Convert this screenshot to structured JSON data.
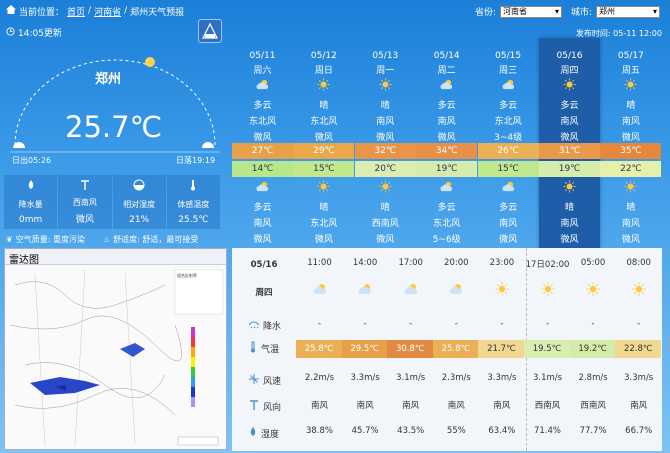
{
  "breadcrumb": {
    "label": "当前位置：",
    "home": "首页",
    "province": "河南省",
    "page": "郑州天气预报",
    "sep": "/"
  },
  "selectors": {
    "province_label": "省份:",
    "province_value": "河南省",
    "city_label": "城市:",
    "city_value": "郑州"
  },
  "update_time": "14:05更新",
  "publish_time": "发布时间:  05-11 12:00",
  "current": {
    "city": "郑州",
    "temp": "25.7℃",
    "sunrise": "日出05:26",
    "sunset": "日落19:19",
    "stats": [
      {
        "icon": "rain-icon",
        "label": "降水量",
        "value": "0mm"
      },
      {
        "icon": "wind-icon",
        "label": "西南风",
        "value": "微风"
      },
      {
        "icon": "humidity-icon",
        "label": "相对湿度",
        "value": "21%"
      },
      {
        "icon": "thermometer-icon",
        "label": "体感温度",
        "value": "25.5℃"
      }
    ],
    "air_quality": "空气质量: 重度污染",
    "comfort": "舒适度: 舒适，最可接受"
  },
  "radar": {
    "title": "雷达图",
    "legend_title": "组合反射率"
  },
  "daily": [
    {
      "date": "05/11",
      "week": "周六",
      "day_icon": "partly-cloudy",
      "day_weather": "多云",
      "day_wind_dir": "东北风",
      "day_wind": "微风",
      "high": "27℃",
      "high_color": "#e8a04a",
      "low": "14℃",
      "low_color": "#b8e68a",
      "night_icon": "partly-cloudy",
      "night_weather": "多云",
      "night_wind_dir": "南风",
      "night_wind": "微风"
    },
    {
      "date": "05/12",
      "week": "周日",
      "day_icon": "sun",
      "day_weather": "晴",
      "day_wind_dir": "东北风",
      "day_wind": "微风",
      "high": "29℃",
      "high_color": "#eba84a",
      "low": "15℃",
      "low_color": "#c2e88e",
      "night_icon": "sun",
      "night_weather": "晴",
      "night_wind_dir": "东北风",
      "night_wind": "微风"
    },
    {
      "date": "05/13",
      "week": "周一",
      "day_icon": "sun",
      "day_weather": "晴",
      "day_wind_dir": "南风",
      "day_wind": "微风",
      "high": "32℃",
      "high_color": "#e8954a",
      "low": "20℃",
      "low_color": "#dcedb0",
      "night_icon": "sun",
      "night_weather": "晴",
      "night_wind_dir": "西南风",
      "night_wind": "微风"
    },
    {
      "date": "05/14",
      "week": "周二",
      "day_icon": "partly-cloudy",
      "day_weather": "多云",
      "day_wind_dir": "南风",
      "day_wind": "微风",
      "high": "34℃",
      "high_color": "#e88f48",
      "low": "19℃",
      "low_color": "#d6ecaa",
      "night_icon": "partly-cloudy",
      "night_weather": "多云",
      "night_wind_dir": "东北风",
      "night_wind": "5~6级"
    },
    {
      "date": "05/15",
      "week": "周三",
      "day_icon": "partly-cloudy",
      "day_weather": "多云",
      "day_wind_dir": "东北风",
      "day_wind": "3~4级",
      "high": "26℃",
      "high_color": "#ebb055",
      "low": "15℃",
      "low_color": "#c2e88e",
      "night_icon": "partly-cloudy",
      "night_weather": "多云",
      "night_wind_dir": "南风",
      "night_wind": "微风"
    },
    {
      "date": "05/16",
      "week": "周四",
      "day_icon": "sun",
      "day_weather": "多云",
      "day_wind_dir": "南风",
      "day_wind": "微风",
      "high": "31℃",
      "high_color": "#e89a4a",
      "low": "19℃",
      "low_color": "#d6ecaa",
      "night_icon": "sun",
      "night_weather": "晴",
      "night_wind_dir": "南风",
      "night_wind": "微风"
    },
    {
      "date": "05/17",
      "week": "周五",
      "day_icon": "sun",
      "day_weather": "晴",
      "day_wind_dir": "南风",
      "day_wind": "微风",
      "high": "35℃",
      "high_color": "#e6873e",
      "low": "22℃",
      "low_color": "#e6f0a8",
      "night_icon": "sun",
      "night_weather": "晴",
      "night_wind_dir": "南风",
      "night_wind": "微风"
    }
  ],
  "hourly": {
    "date": "05/16",
    "week": "周四",
    "times": [
      "11:00",
      "14:00",
      "17:00",
      "20:00",
      "23:00",
      "17日02:00",
      "05:00",
      "08:00"
    ],
    "icons": [
      "partly-cloudy",
      "partly-cloudy",
      "partly-cloudy",
      "partly-cloudy",
      "sun",
      "sun",
      "sun",
      "sun"
    ],
    "row_labels": {
      "rain": "降水",
      "temp": "气温",
      "wind_speed": "风速",
      "wind_dir": "风向",
      "humidity": "湿度"
    },
    "rain": [
      "-",
      "-",
      "-",
      "-",
      "-",
      "-",
      "-",
      "-"
    ],
    "temp": [
      "25.8℃",
      "29.5℃",
      "30.8℃",
      "25.8℃",
      "21.7℃",
      "19.5℃",
      "19.2℃",
      "22.8℃"
    ],
    "temp_colors": [
      "#ebb055",
      "#e8a04a",
      "#e08a44",
      "#ebb055",
      "#f0d890",
      "#d8eeb0",
      "#d4ecaa",
      "#f0d890"
    ],
    "wind_speed": [
      "2.2m/s",
      "3.3m/s",
      "3.1m/s",
      "2.3m/s",
      "3.3m/s",
      "3.1m/s",
      "2.8m/s",
      "3.3m/s"
    ],
    "wind_dir": [
      "南风",
      "南风",
      "南风",
      "南风",
      "南风",
      "西南风",
      "西南风",
      "南风"
    ],
    "humidity": [
      "38.8%",
      "45.7%",
      "43.5%",
      "55%",
      "63.4%",
      "71.4%",
      "77.7%",
      "66.7%"
    ]
  }
}
